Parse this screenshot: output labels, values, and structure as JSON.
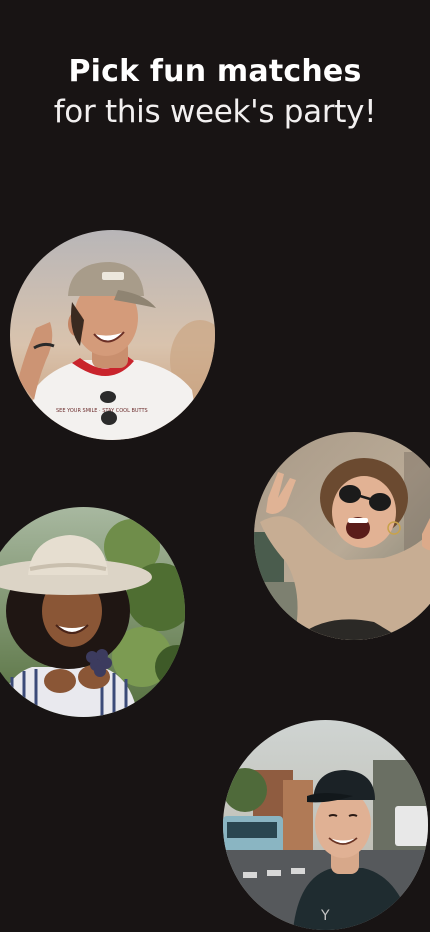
{
  "heading": {
    "line1": "Pick fun matches",
    "line2": "for this week's party!"
  },
  "matches": [
    {
      "id": "match-1",
      "shirt_text": "SEE YOUR SMILE · STAY COOL BUTTS"
    },
    {
      "id": "match-2"
    },
    {
      "id": "match-3"
    },
    {
      "id": "match-4"
    }
  ],
  "colors": {
    "background": "#181414",
    "text": "#ffffff"
  }
}
